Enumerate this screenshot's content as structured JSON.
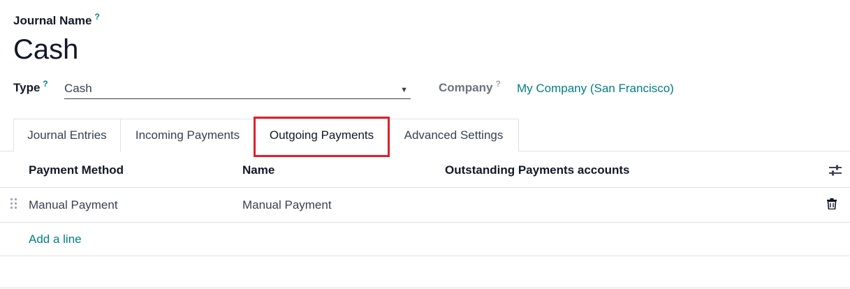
{
  "form": {
    "journal_name_label": "Journal Name",
    "help_mark": "?",
    "journal_name_value": "Cash",
    "type_label": "Type",
    "type_value": "Cash",
    "company_label": "Company",
    "company_value": "My Company (San Francisco)"
  },
  "tabs": [
    {
      "label": "Journal Entries",
      "active": false
    },
    {
      "label": "Incoming Payments",
      "active": false
    },
    {
      "label": "Outgoing Payments",
      "active": true
    },
    {
      "label": "Advanced Settings",
      "active": false
    }
  ],
  "table": {
    "columns": [
      "Payment Method",
      "Name",
      "Outstanding Payments accounts"
    ],
    "rows": [
      {
        "payment_method": "Manual Payment",
        "name": "Manual Payment",
        "outstanding_account": ""
      }
    ],
    "add_line_label": "Add a line"
  },
  "colors": {
    "accent": "#017e84",
    "highlight": "#e0202a"
  },
  "icons": {
    "settings": "sliders-icon",
    "delete": "trash-icon",
    "drag": "drag-handle-icon",
    "dropdown": "caret-down-icon"
  }
}
